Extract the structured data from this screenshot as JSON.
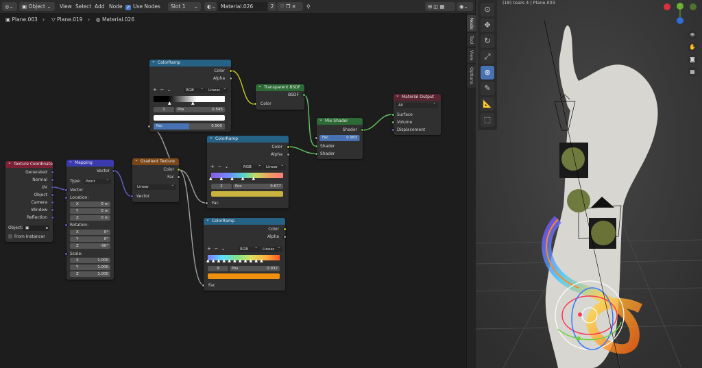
{
  "header": {
    "editor_type_icon": "node-editor-icon",
    "mode": "Object",
    "menus": [
      "View",
      "Select",
      "Add",
      "Node"
    ],
    "use_nodes_label": "Use Nodes",
    "slot": "Slot 1",
    "material_name": "Material.026",
    "user_count": "2"
  },
  "breadcrumb": {
    "items": [
      "Plane.003",
      "Plane.019",
      "Material.026"
    ]
  },
  "npanel_tabs": [
    "Node",
    "Tool",
    "View",
    "Options"
  ],
  "nodes": {
    "texcoord": {
      "title": "Texture Coordinate",
      "outputs": [
        "Generated",
        "Normal",
        "UV",
        "Object",
        "Camera",
        "Window",
        "Reflection"
      ],
      "object_label": "Object:",
      "from_instancer": "From Instancer"
    },
    "mapping": {
      "title": "Mapping",
      "output": "Vector",
      "type_label": "Type:",
      "type_value": "Point",
      "vector_label": "Vector",
      "location_label": "Location:",
      "rotation_label": "Rotation:",
      "scale_label": "Scale:",
      "location": [
        {
          "axis": "X",
          "value": "0 m"
        },
        {
          "axis": "Y",
          "value": "0 m"
        },
        {
          "axis": "Z",
          "value": "0 m"
        }
      ],
      "rotation": [
        {
          "axis": "X",
          "value": "0°"
        },
        {
          "axis": "Y",
          "value": "0°"
        },
        {
          "axis": "Z",
          "value": "-90°"
        }
      ],
      "scale": [
        {
          "axis": "X",
          "value": "1.000"
        },
        {
          "axis": "Y",
          "value": "1.000"
        },
        {
          "axis": "Z",
          "value": "1.000"
        }
      ]
    },
    "gradient": {
      "title": "Gradient Texture",
      "outputs": [
        "Color",
        "Fac"
      ],
      "mode": "Linear",
      "input": "Vector"
    },
    "ramp1": {
      "title": "ColorRamp",
      "outputs": [
        "Color",
        "Alpha"
      ],
      "color_mode": "RGB",
      "interp": "Linear",
      "index": "1",
      "pos_label": "Pos",
      "pos": "0.545",
      "fac_label": "Fac",
      "fac_value": "0.500",
      "fac_fraction": 0.5
    },
    "ramp2": {
      "title": "ColorRamp",
      "outputs": [
        "Color",
        "Alpha"
      ],
      "color_mode": "RGB",
      "interp": "Linear",
      "index": "2",
      "pos_label": "Pos",
      "pos": "0.677",
      "fac_label": "Fac",
      "selected_color": "#c9b23e"
    },
    "ramp3": {
      "title": "ColorRamp",
      "outputs": [
        "Color",
        "Alpha"
      ],
      "color_mode": "RGB",
      "interp": "Linear",
      "index": "9",
      "pos_label": "Pos",
      "pos": "0.932",
      "fac_label": "Fac",
      "selected_color": "#f0900e"
    },
    "transparent": {
      "title": "Transparent BSDF",
      "output": "BSDF",
      "input": "Color"
    },
    "mix": {
      "title": "Mix Shader",
      "output": "Shader",
      "fac_label": "Fac",
      "fac_value": "0.983",
      "fac_fraction": 0.983,
      "inputs": [
        "Shader",
        "Shader"
      ]
    },
    "output": {
      "title": "Material Output",
      "target": "All",
      "inputs": [
        "Surface",
        "Volume",
        "Displacement"
      ]
    }
  },
  "viewport": {
    "info": "(18) tears 4 | Plane.003",
    "tools": [
      "cursor-icon",
      "move-icon",
      "rotate-icon",
      "scale-icon",
      "transform-icon",
      "annotate-icon",
      "measure-icon",
      "add-cube-icon"
    ]
  },
  "colors": {
    "accent": "#4772b3",
    "color_header": "#266186",
    "shader_header": "#2c6a36",
    "output_header": "#5a2330"
  }
}
